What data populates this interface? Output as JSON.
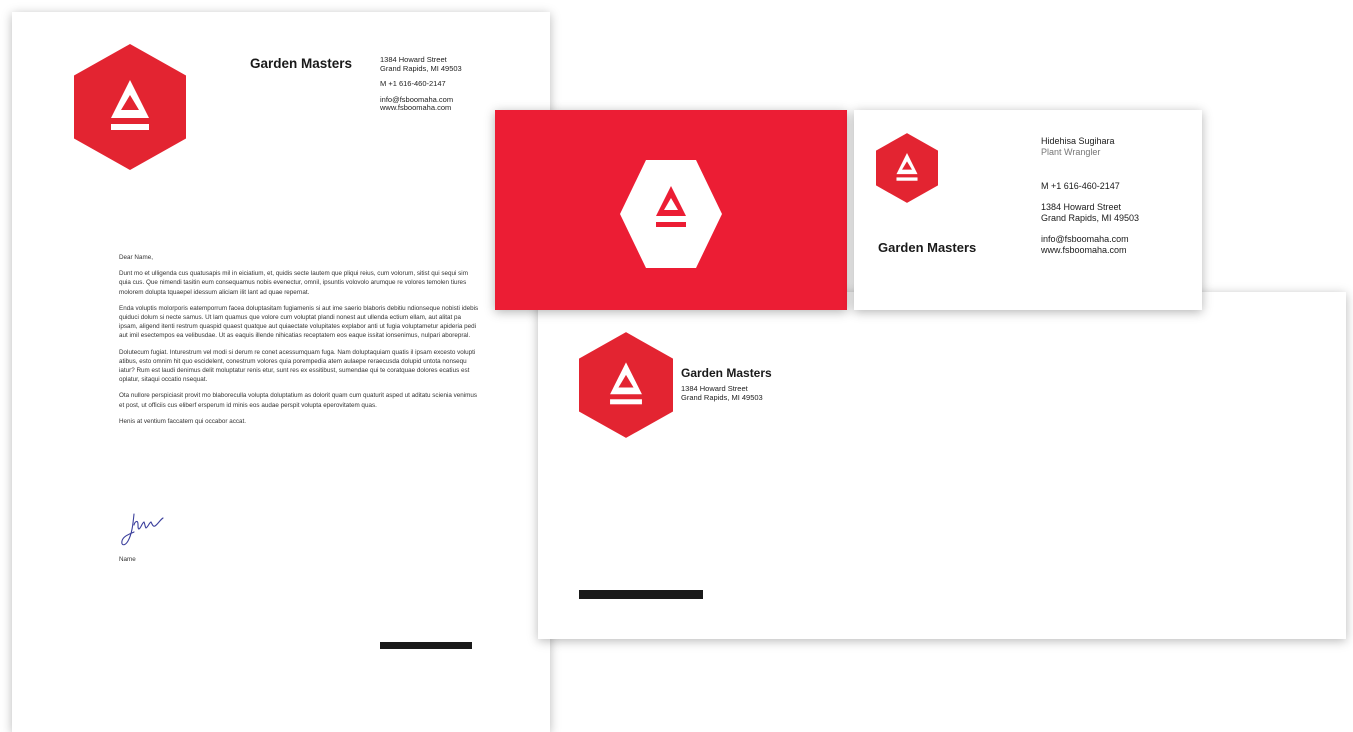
{
  "colors": {
    "brand_red": "#e32431",
    "card_red": "#ec1d34",
    "ink": "#1a1a1a",
    "signature_ink": "#3b3f9c"
  },
  "logo": {
    "icon": "triangle-over-bar-hexagon-icon"
  },
  "letterhead": {
    "company": "Garden Masters",
    "address": [
      "1384 Howard Street",
      "Grand Rapids, MI 49503"
    ],
    "phone": "M +1 616-460-2147",
    "email": "info@fsboomaha.com",
    "website": "www.fsboomaha.com",
    "salutation": "Dear Name,",
    "paragraphs": [
      "Dunt mo et ulligenda cus quatusapis mil in eiciatium, et, quidis secte lautem que pliqui reius, cum volorum, sitist qui sequi sim quia cus. Que nimendi tasitin eum consequamus nobis evenectur, omnil, ipsuntis volovolo arumque re volores temolen tiures molorem dolupta tquaepel idessum aliciam ilit lant ad quae repernat.",
      "Enda voluptis molorporis eatemporrum facea doluptasitam fugiamenis si aut ime saerio blaboris debitiu ndionseque nobisti idebis quiduci dolum si necte samus. Ut lam quamus que volore cum voluptat plandi nonest aut ullenda ectium ellam, aut alitat pa ipsam, aligend itenti restrum quaspid quaest quatque aut quiaectate volupitates explabor anti ut fugia voluptametur apideria pedi aut imil esectempos ea velibusdae. Ut as eaquis illende nihicatias receptatem eos eaque issitat ionsenimus, nulpari aborepral.",
      "Dolutecum fugiat. Inturestrum vel modi si derum re conet acessumquam fuga. Nam doluptaquiam quatis il ipsam excesto volupti atibus, esto omnim hit quo escidelent, conestrum volores quia porempedia atem aulaepe reraecusda dolupid untota nonsequ iatur? Rum est laudi denimus delit moluptatur renis etur, sunt res ex essitibust, sumendae qui te coratquae dolores ecatius est oplatur, sitaqui occatio nsequat.",
      "Ota nullore perspiciasit provit mo blaboreculla volupta doluptatium as dolorit quam cum quaturit asped ut aditatu scienia venimus et post, ut officiis cus eliberf ersperum id minis eos audae perspit volupta eperovitatem quas.",
      "Henis at ventium faccatem qui occabor accat."
    ],
    "signature_name": "Name"
  },
  "business_card": {
    "person_name": "Hidehisa Sugihara",
    "person_title": "Plant Wrangler",
    "phone": "M  +1 616-460-2147",
    "address": [
      "1384 Howard Street",
      "Grand Rapids, MI 49503"
    ],
    "email": "info@fsboomaha.com",
    "website": "www.fsboomaha.com",
    "company": "Garden Masters"
  },
  "envelope": {
    "company": "Garden Masters",
    "address": [
      "1384 Howard Street",
      "Grand Rapids, MI 49503"
    ]
  }
}
